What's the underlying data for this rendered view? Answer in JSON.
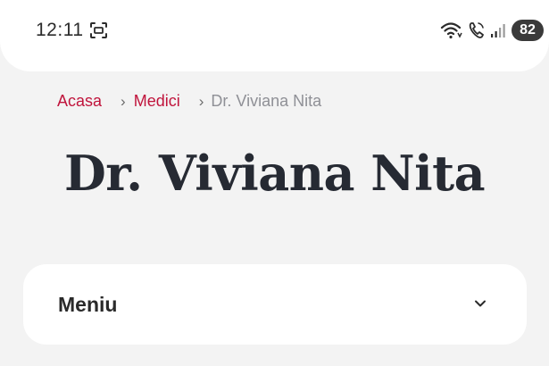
{
  "status_bar": {
    "time": "12:11",
    "battery_level": "82",
    "icons": [
      "screenshot-icon",
      "wifi-icon",
      "call-icon",
      "signal-icon",
      "battery-icon"
    ]
  },
  "breadcrumb": {
    "items": [
      {
        "label": "Acasa",
        "link": true
      },
      {
        "label": "Medici",
        "link": true
      },
      {
        "label": "Dr. Viviana Nita",
        "link": false
      }
    ],
    "separator": "›"
  },
  "page": {
    "title": "Dr. Viviana Nita"
  },
  "menu": {
    "label": "Meniu",
    "expanded": false
  },
  "colors": {
    "accent": "#c0143c",
    "background": "#f3f3f3",
    "card": "#ffffff",
    "title": "#262a33"
  }
}
